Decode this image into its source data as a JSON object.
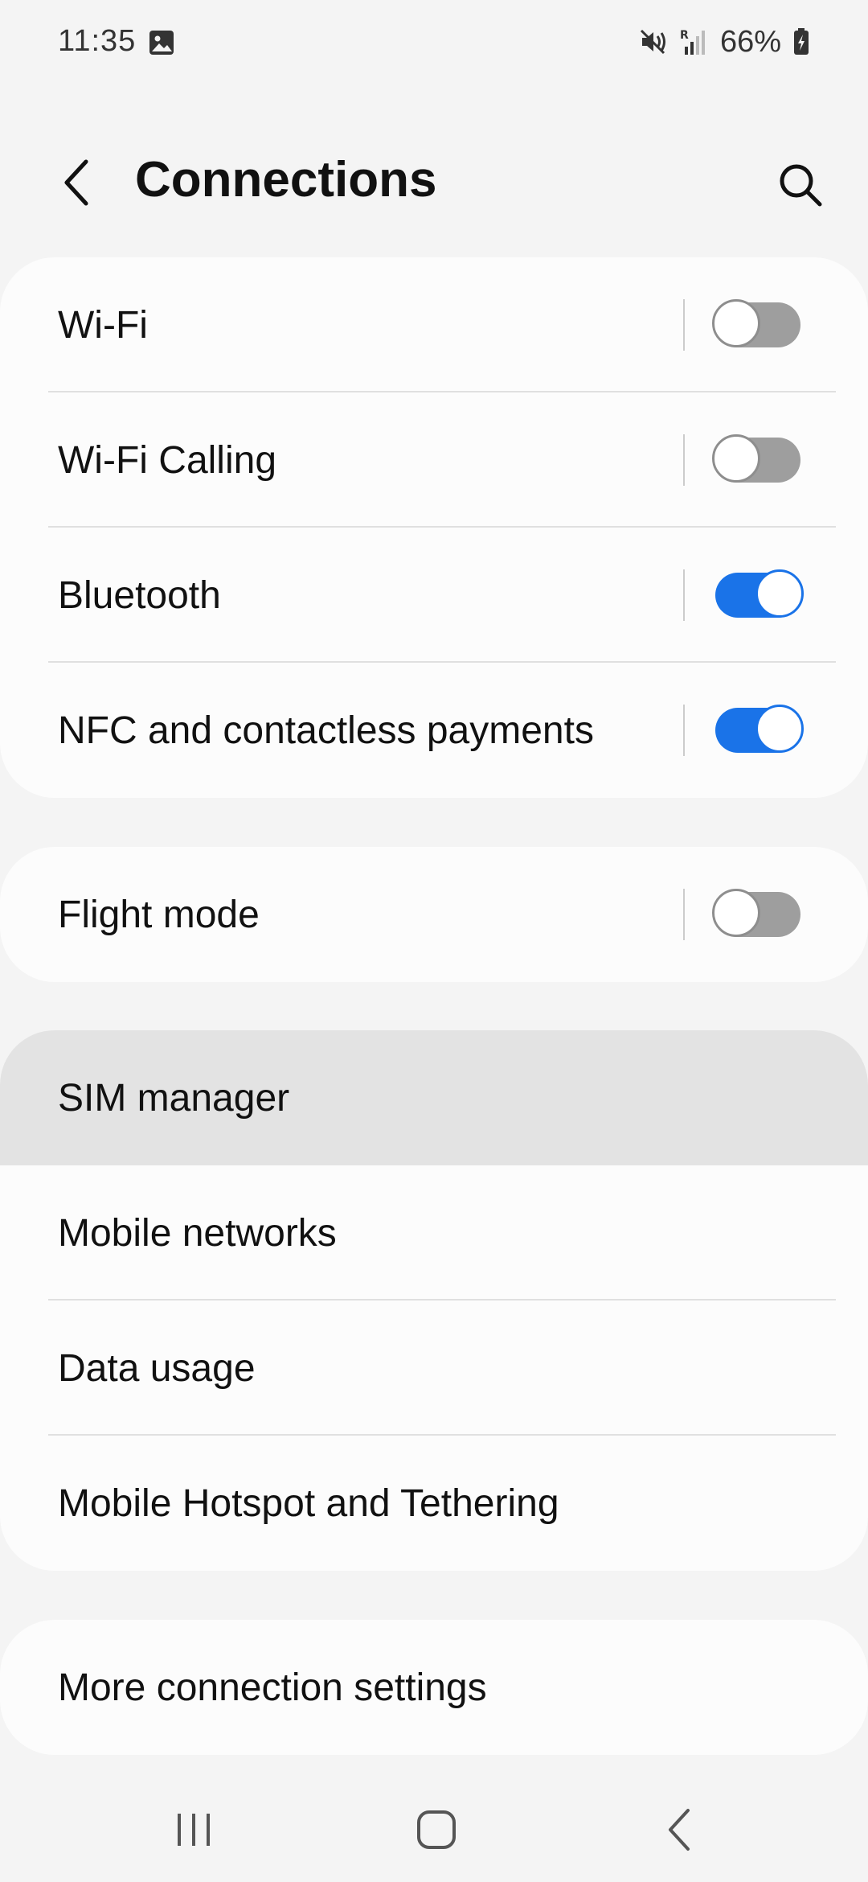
{
  "status_bar": {
    "time": "11:35",
    "battery": "66%",
    "icons": [
      "image-notification-icon",
      "mute-icon",
      "signal-icon",
      "battery-icon"
    ]
  },
  "header": {
    "title": "Connections",
    "back_icon": "back-arrow-icon",
    "search_icon": "search-icon"
  },
  "groups": [
    {
      "items": [
        {
          "label": "Wi-Fi",
          "toggle": false
        },
        {
          "label": "Wi-Fi Calling",
          "toggle": false
        },
        {
          "label": "Bluetooth",
          "toggle": true
        },
        {
          "label": "NFC and contactless payments",
          "toggle": true
        }
      ]
    },
    {
      "items": [
        {
          "label": "Flight mode",
          "toggle": false
        }
      ]
    },
    {
      "items": [
        {
          "label": "SIM manager",
          "highlighted": true
        },
        {
          "label": "Mobile networks"
        },
        {
          "label": "Data usage"
        },
        {
          "label": "Mobile Hotspot and Tethering"
        }
      ]
    },
    {
      "items": [
        {
          "label": "More connection settings"
        }
      ]
    }
  ],
  "nav_bar": {
    "icons": [
      "recent-apps-icon",
      "home-icon",
      "back-icon"
    ]
  },
  "colors": {
    "background": "#f4f4f4",
    "card": "#fcfcfc",
    "toggle_on": "#1a73e8",
    "toggle_off": "#9e9e9e",
    "highlight": "#e3e3e3"
  }
}
